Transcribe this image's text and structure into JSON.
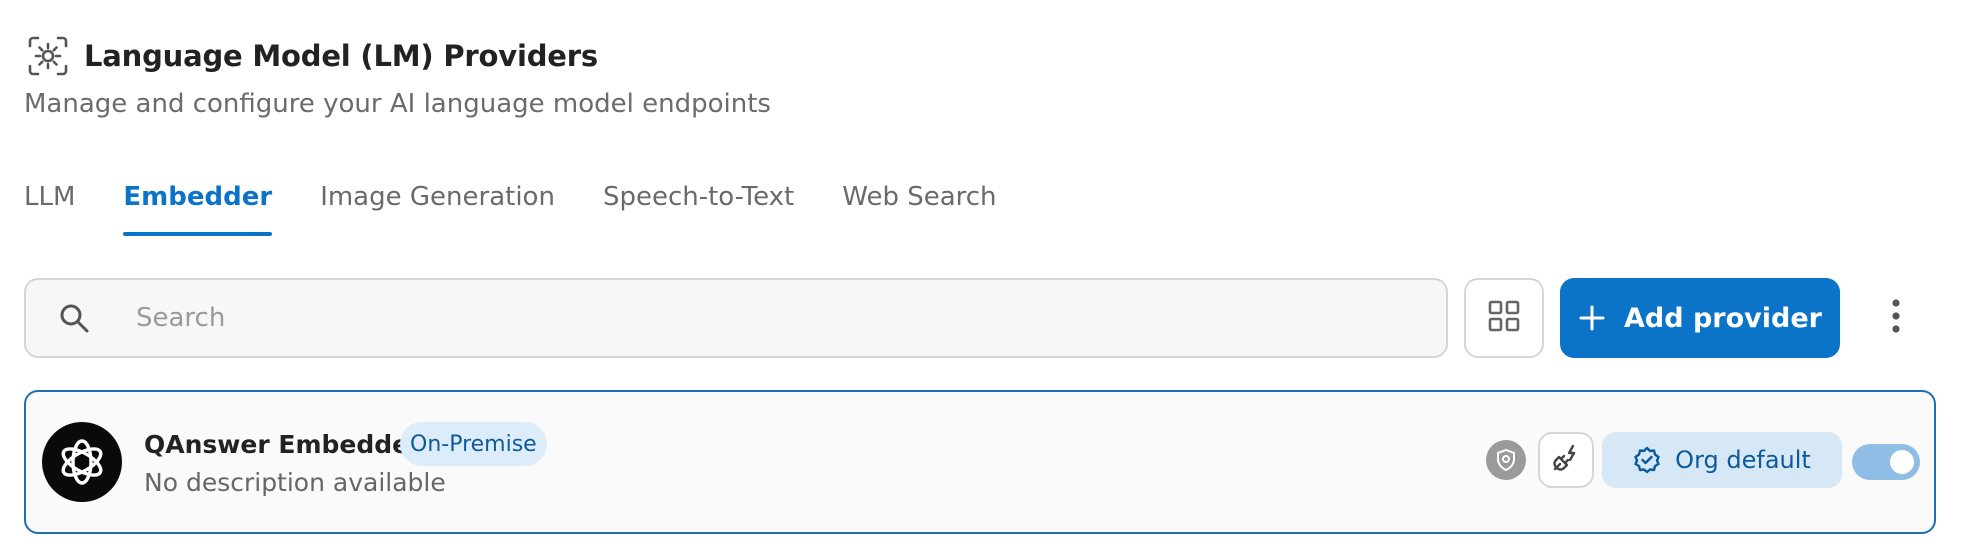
{
  "header": {
    "icon": "settings-box-icon",
    "title": "Language Model (LM) Providers",
    "subtitle": "Manage and configure your AI language model endpoints"
  },
  "tabs": [
    {
      "label": "LLM",
      "active": false
    },
    {
      "label": "Embedder",
      "active": true
    },
    {
      "label": "Image Generation",
      "active": false
    },
    {
      "label": "Speech-to-Text",
      "active": false
    },
    {
      "label": "Web Search",
      "active": false
    }
  ],
  "toolbar": {
    "search_placeholder": "Search",
    "search_value": "",
    "grid_icon": "grid-view-icon",
    "add_label": "Add provider",
    "more_icon": "more-vertical-icon"
  },
  "providers": [
    {
      "name": "QAnswer Embedder",
      "badge": "On-Premise",
      "description": "No description available",
      "logo_icon": "openai-logo-icon",
      "org_default_label": "Org default",
      "enabled": true
    }
  ],
  "colors": {
    "accent": "#0b74c8",
    "badge_bg": "#dcecf8",
    "card_border": "#1e6fb0"
  }
}
